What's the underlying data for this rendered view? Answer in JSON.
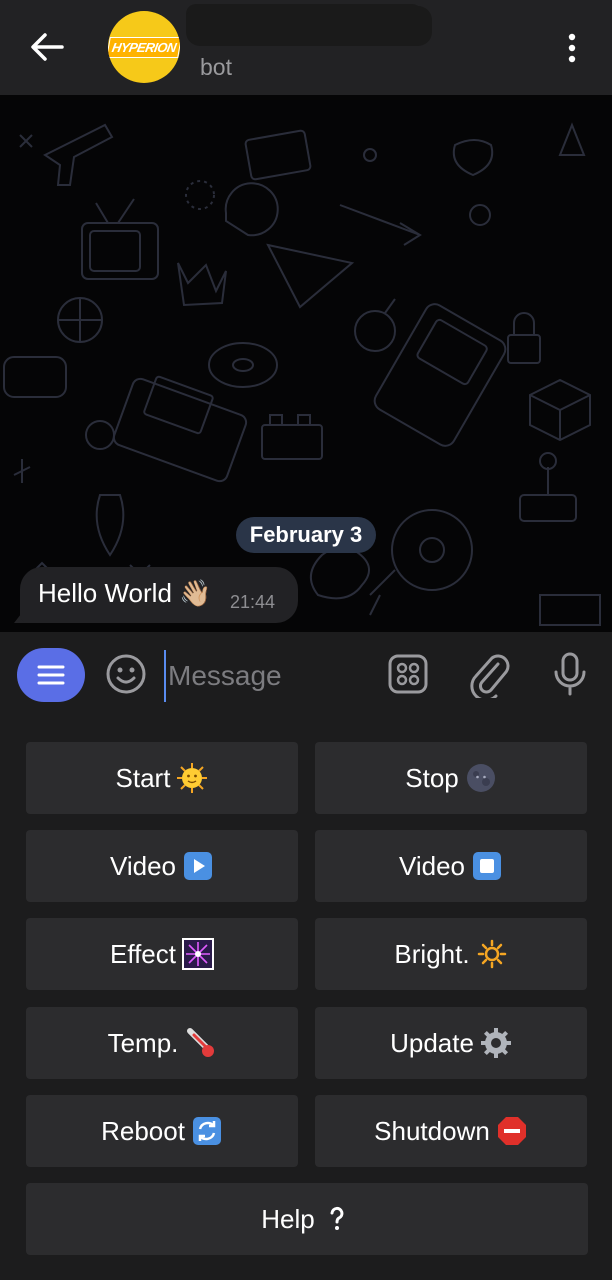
{
  "header": {
    "subtitle": "bot",
    "avatar_text": "HYPERION"
  },
  "chat": {
    "date_label": "February 3",
    "messages": [
      {
        "text": "Hello World 👋🏼",
        "time": "21:44"
      }
    ]
  },
  "input": {
    "placeholder": "Message"
  },
  "keyboard": {
    "buttons": [
      {
        "label": "Start",
        "icon": "sun-face-icon"
      },
      {
        "label": "Stop",
        "icon": "new-moon-face-icon"
      },
      {
        "label": "Video",
        "icon": "play-button-icon"
      },
      {
        "label": "Video",
        "icon": "stop-button-icon"
      },
      {
        "label": "Effect",
        "icon": "sparkler-icon"
      },
      {
        "label": "Bright.",
        "icon": "bright-sun-icon"
      },
      {
        "label": "Temp.",
        "icon": "thermometer-icon"
      },
      {
        "label": "Update",
        "icon": "gear-icon"
      },
      {
        "label": "Reboot",
        "icon": "refresh-icon"
      },
      {
        "label": "Shutdown",
        "icon": "stop-sign-icon"
      },
      {
        "label": "Help",
        "icon": "question-mark-icon"
      }
    ]
  },
  "colors": {
    "accent": "#5a6ee6",
    "date_pill": "#2a3548",
    "avatar_bg": "#f6c919"
  }
}
